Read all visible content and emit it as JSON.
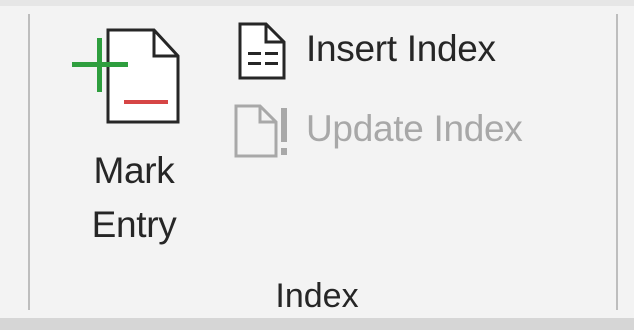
{
  "group": {
    "label": "Index"
  },
  "buttons": {
    "mark_entry": {
      "label_line1": "Mark",
      "label_line2": "Entry",
      "icon": "mark-entry-icon",
      "enabled": true
    },
    "insert_index": {
      "label": "Insert Index",
      "icon": "insert-index-icon",
      "enabled": true
    },
    "update_index": {
      "label": "Update Index",
      "icon": "update-index-icon",
      "enabled": false
    }
  },
  "colors": {
    "background": "#f3f3f3",
    "text": "#262626",
    "disabled_text": "#a8a8a8",
    "plus_green": "#2e9e3e",
    "minus_red": "#d64545",
    "separator": "#bdbdbd"
  }
}
